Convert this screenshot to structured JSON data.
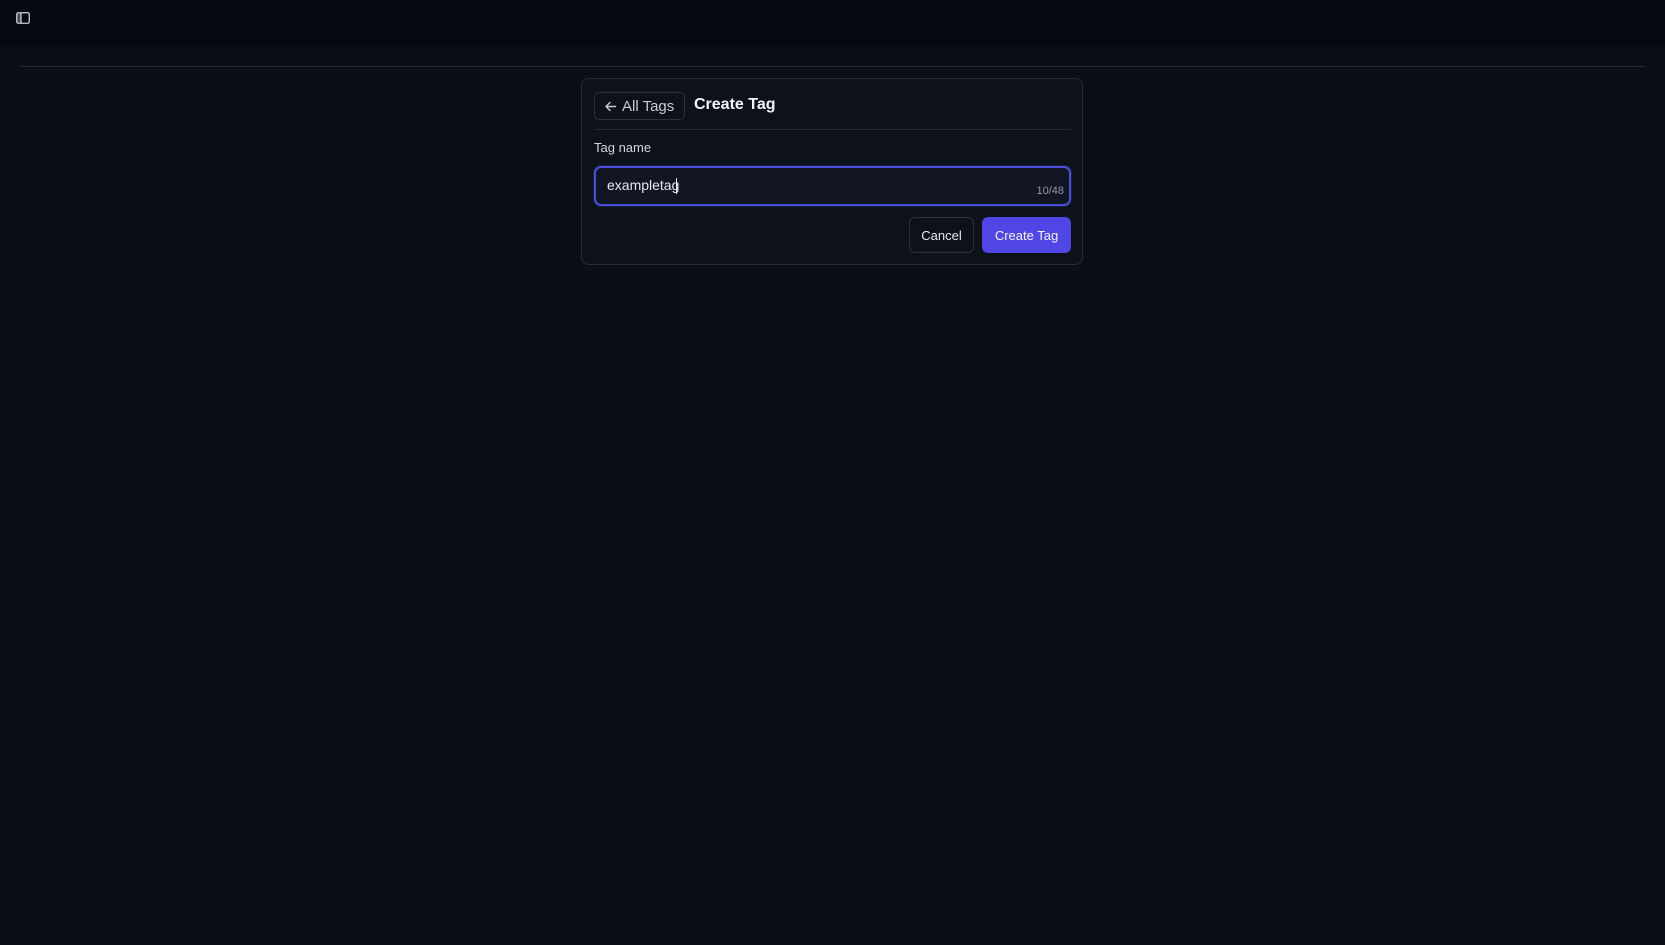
{
  "topbar": {
    "toggle_icon": "sidebar-toggle-icon"
  },
  "card": {
    "back_label": "All Tags",
    "back_icon": "arrow-left-icon",
    "title": "Create Tag"
  },
  "form": {
    "label": "Tag name",
    "value": "exampletag",
    "char_count": "10/48"
  },
  "actions": {
    "cancel_label": "Cancel",
    "submit_label": "Create Tag"
  },
  "colors": {
    "accent": "#4f46e5",
    "background": "#0b0e15",
    "topbar": "#050810"
  }
}
